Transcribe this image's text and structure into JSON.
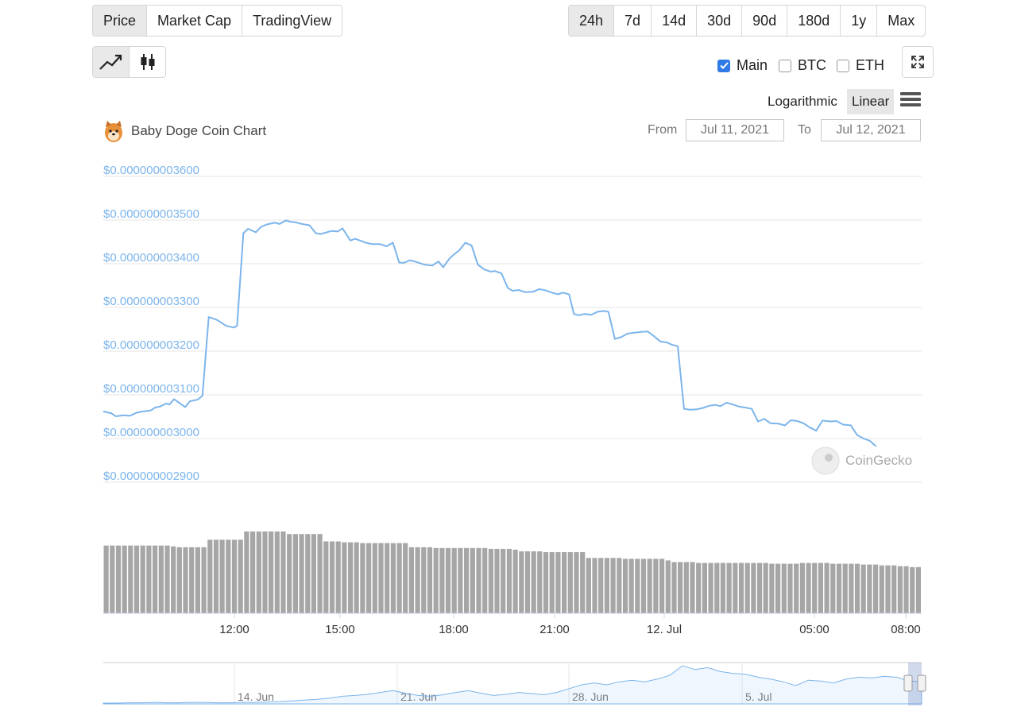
{
  "metric_tabs": [
    "Price",
    "Market Cap",
    "TradingView"
  ],
  "active_metric": "Price",
  "range_tabs": [
    "24h",
    "7d",
    "14d",
    "30d",
    "90d",
    "180d",
    "1y",
    "Max"
  ],
  "active_range": "24h",
  "chart_types": [
    "line-chart-icon",
    "candlestick-icon"
  ],
  "compare": [
    {
      "label": "Main",
      "checked": true
    },
    {
      "label": "BTC",
      "checked": false
    },
    {
      "label": "ETH",
      "checked": false
    }
  ],
  "scale_options": [
    "Logarithmic",
    "Linear"
  ],
  "active_scale": "Linear",
  "chart_title": "Baby Doge Coin Chart",
  "date_range": {
    "from_label": "From",
    "from_value": "Jul 11, 2021",
    "to_label": "To",
    "to_value": "Jul 12, 2021"
  },
  "credit": "CoinGecko",
  "colors": {
    "line": "#7cb5ec",
    "volume": "#a6a6a6",
    "checkbox": "#2f7ae5"
  },
  "chart_data": {
    "type": "line",
    "title": "Baby Doge Coin Chart",
    "x_tick_labels": [
      "12:00",
      "15:00",
      "18:00",
      "21:00",
      "12. Jul",
      "05:00",
      "08:00"
    ],
    "y_tick_labels": [
      "$0.000000003600",
      "$0.000000003500",
      "$0.000000003400",
      "$0.000000003300",
      "$0.000000003200",
      "$0.000000003100",
      "$0.000000003000",
      "$0.000000002900"
    ],
    "ylim": [
      2.9e-09,
      3.6e-09
    ],
    "x_hours_after_start": [
      0,
      0.5,
      0.8,
      1.3,
      1.7,
      2.1,
      2.5,
      3,
      3.3,
      3.6,
      4,
      4.2,
      4.5,
      5.2,
      5.5,
      6,
      6.3,
      6.7,
      7.2,
      7.5,
      7.8,
      8.3,
      8.5,
      8.9,
      9.2,
      9.7,
      10,
      10.4,
      10.9,
      11.2,
      11.6,
      11.9,
      12.2,
      12.5,
      12.8,
      13.1,
      13.5,
      13.8,
      14.2,
      14.5,
      14.9,
      15.2,
      15.7,
      16,
      16.4,
      16.7,
      17.1,
      17.6,
      18,
      18.4,
      18.8,
      19.1,
      19.5,
      19.8,
      20.4,
      20.9,
      21.3,
      21.6,
      22,
      22.3,
      22.6,
      23,
      23.4,
      23.8,
      24.2,
      24.6,
      24.9,
      25.3,
      25.7,
      26,
      26.4,
      26.8,
      27.3,
      27.7,
      28.1,
      28.5,
      28.9,
      29.2,
      29.6,
      29.9,
      30.2,
      30.6,
      31,
      31.4,
      31.8,
      32.1,
      32.5,
      32.9,
      33.3,
      33.7,
      34.2,
      34.6,
      35,
      35.4,
      35.8,
      36.1,
      36.5,
      36.9,
      37.3,
      37.7,
      38.1,
      38.5,
      38.9,
      39.2,
      39.6,
      40,
      40.4,
      40.8,
      41.2,
      41.6,
      42,
      42.4,
      42.9,
      43.3,
      43.7,
      44.1,
      44.5,
      44.9,
      45.3,
      45.7,
      46.2,
      46.6,
      47,
      47.5,
      47.9,
      48.3,
      48.7,
      49.1,
      49.6,
      50,
      50.4,
      50.8,
      51.2,
      51.6,
      52
    ],
    "price_usd": [
      3.062e-09,
      3.058e-09,
      3.051e-09,
      3.053e-09,
      3.052e-09,
      3.059e-09,
      3.062e-09,
      3.064e-09,
      3.071e-09,
      3.073e-09,
      3.08e-09,
      3.078e-09,
      3.09e-09,
      3.072e-09,
      3.085e-09,
      3.089e-09,
      3.098e-09,
      3.278e-09,
      3.272e-09,
      3.265e-09,
      3.258e-09,
      3.254e-09,
      3.258e-09,
      3.47e-09,
      3.48e-09,
      3.472e-09,
      3.484e-09,
      3.49e-09,
      3.494e-09,
      3.491e-09,
      3.499e-09,
      3.496e-09,
      3.495e-09,
      3.492e-09,
      3.49e-09,
      3.488e-09,
      3.47e-09,
      3.468e-09,
      3.472e-09,
      3.475e-09,
      3.474e-09,
      3.481e-09,
      3.453e-09,
      3.457e-09,
      3.452e-09,
      3.448e-09,
      3.445e-09,
      3.445e-09,
      3.44e-09,
      3.448e-09,
      3.403e-09,
      3.402e-09,
      3.408e-09,
      3.405e-09,
      3.398e-09,
      3.396e-09,
      3.405e-09,
      3.392e-09,
      3.412e-09,
      3.422e-09,
      3.43e-09,
      3.448e-09,
      3.442e-09,
      3.398e-09,
      3.387e-09,
      3.382e-09,
      3.383e-09,
      3.378e-09,
      3.345e-09,
      3.338e-09,
      3.34e-09,
      3.335e-09,
      3.336e-09,
      3.342e-09,
      3.339e-09,
      3.334e-09,
      3.33e-09,
      3.334e-09,
      3.33e-09,
      3.285e-09,
      3.282e-09,
      3.285e-09,
      3.283e-09,
      3.29e-09,
      3.292e-09,
      3.29e-09,
      3.228e-09,
      3.232e-09,
      3.24e-09,
      3.242e-09,
      3.244e-09,
      3.245e-09,
      3.234e-09,
      3.222e-09,
      3.22e-09,
      3.215e-09,
      3.211e-09,
      3.068e-09,
      3.066e-09,
      3.067e-09,
      3.07e-09,
      3.075e-09,
      3.077e-09,
      3.074e-09,
      3.082e-09,
      3.078e-09,
      3.073e-09,
      3.071e-09,
      3.068e-09,
      3.039e-09,
      3.045e-09,
      3.035e-09,
      3.034e-09,
      3.03e-09,
      3.042e-09,
      3.04e-09,
      3.035e-09,
      3.025e-09,
      3.018e-09,
      3.041e-09,
      3.039e-09,
      3.04e-09,
      3.032e-09,
      3.03e-09,
      3.008e-09,
      3e-09,
      2.995e-09,
      2.982e-09
    ],
    "volume_relative": [
      0.82,
      0.82,
      0.82,
      0.82,
      0.82,
      0.82,
      0.82,
      0.82,
      0.82,
      0.82,
      0.82,
      0.81,
      0.8,
      0.8,
      0.8,
      0.8,
      0.8,
      0.89,
      0.89,
      0.89,
      0.89,
      0.89,
      0.89,
      0.99,
      0.99,
      0.99,
      0.99,
      0.99,
      0.99,
      0.99,
      0.96,
      0.96,
      0.96,
      0.96,
      0.96,
      0.96,
      0.87,
      0.87,
      0.87,
      0.86,
      0.86,
      0.86,
      0.85,
      0.85,
      0.85,
      0.85,
      0.85,
      0.85,
      0.85,
      0.85,
      0.8,
      0.8,
      0.8,
      0.8,
      0.79,
      0.79,
      0.79,
      0.79,
      0.79,
      0.79,
      0.79,
      0.79,
      0.79,
      0.78,
      0.78,
      0.78,
      0.78,
      0.77,
      0.75,
      0.75,
      0.75,
      0.75,
      0.74,
      0.74,
      0.74,
      0.74,
      0.74,
      0.74,
      0.74,
      0.67,
      0.67,
      0.67,
      0.67,
      0.67,
      0.67,
      0.66,
      0.66,
      0.66,
      0.66,
      0.66,
      0.66,
      0.66,
      0.64,
      0.62,
      0.62,
      0.62,
      0.62,
      0.61,
      0.61,
      0.61,
      0.61,
      0.61,
      0.61,
      0.61,
      0.61,
      0.61,
      0.61,
      0.61,
      0.61,
      0.6,
      0.6,
      0.6,
      0.6,
      0.6,
      0.61,
      0.61,
      0.61,
      0.61,
      0.61,
      0.6,
      0.6,
      0.6,
      0.6,
      0.6,
      0.59,
      0.59,
      0.59,
      0.58,
      0.58,
      0.58,
      0.57,
      0.57,
      0.56,
      0.56
    ],
    "navigator": {
      "labels": [
        "14. Jun",
        "21. Jun",
        "28. Jun",
        "5. Jul"
      ],
      "series": [
        0.02,
        0.02,
        0.03,
        0.03,
        0.04,
        0.03,
        0.03,
        0.04,
        0.04,
        0.03,
        0.03,
        0.04,
        0.04,
        0.05,
        0.06,
        0.08,
        0.1,
        0.12,
        0.15,
        0.2,
        0.22,
        0.25,
        0.3,
        0.35,
        0.28,
        0.22,
        0.2,
        0.24,
        0.3,
        0.35,
        0.28,
        0.22,
        0.25,
        0.3,
        0.27,
        0.24,
        0.3,
        0.4,
        0.5,
        0.55,
        0.5,
        0.58,
        0.62,
        0.58,
        0.65,
        0.75,
        1.0,
        0.9,
        0.95,
        0.85,
        0.8,
        0.78,
        0.7,
        0.65,
        0.58,
        0.48,
        0.62,
        0.6,
        0.55,
        0.65,
        0.7,
        0.68,
        0.72,
        0.7,
        0.6,
        0.58
      ]
    }
  }
}
